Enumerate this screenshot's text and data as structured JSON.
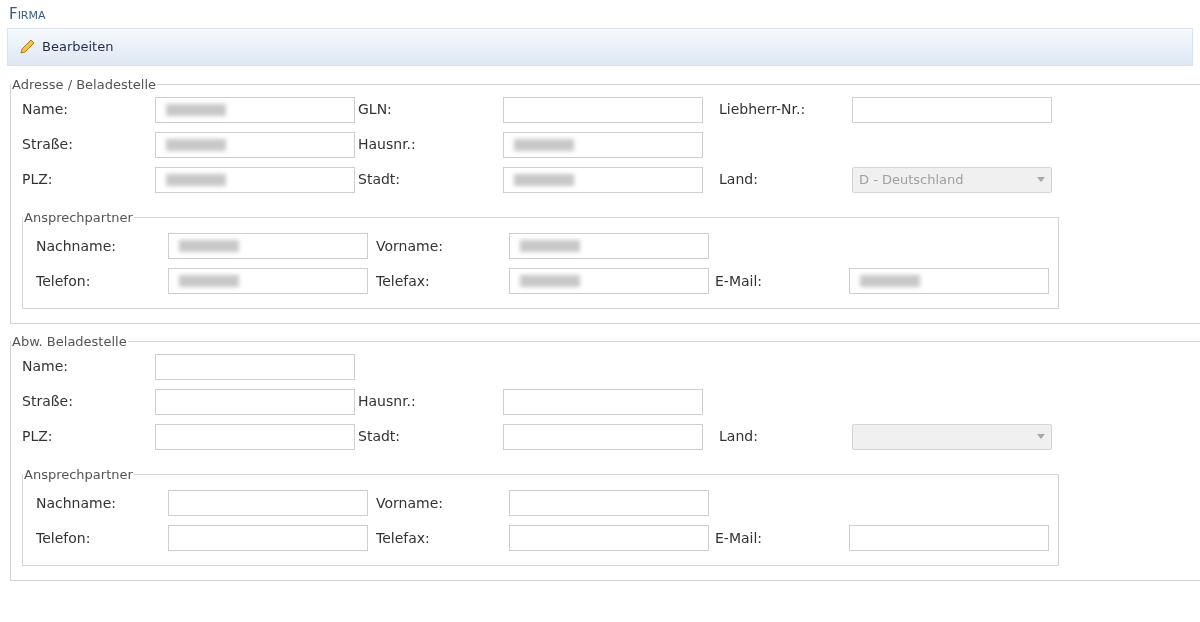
{
  "title": "Firma",
  "toolbar": [
    {
      "label": "Bearbeiten"
    }
  ],
  "sections": [
    {
      "legend": "Adresse / Beladestelle",
      "rows": [
        [
          {
            "label": "Name:",
            "field": {
              "kind": "text",
              "redacted": true
            }
          },
          {
            "label": "GLN:",
            "field": {
              "kind": "text",
              "redacted": false
            }
          },
          {
            "label": "Liebherr-Nr.:",
            "field": {
              "kind": "text",
              "redacted": false
            }
          }
        ],
        [
          {
            "label": "Straße:",
            "field": {
              "kind": "text",
              "redacted": true
            }
          },
          {
            "label": "Hausnr.:",
            "field": {
              "kind": "text",
              "redacted": true
            }
          }
        ],
        [
          {
            "label": "PLZ:",
            "field": {
              "kind": "text",
              "redacted": true
            }
          },
          {
            "label": "Stadt:",
            "field": {
              "kind": "text",
              "redacted": true
            }
          },
          {
            "label": "Land:",
            "field": {
              "kind": "select",
              "value": "D - Deutschland",
              "redacted": false
            }
          }
        ]
      ],
      "contact": {
        "legend": "Ansprechpartner",
        "rows": [
          [
            {
              "label": "Nachname:",
              "field": {
                "kind": "text",
                "redacted": true
              }
            },
            {
              "label": "Vorname:",
              "field": {
                "kind": "text",
                "redacted": true
              }
            }
          ],
          [
            {
              "label": "Telefon:",
              "field": {
                "kind": "text",
                "redacted": true
              }
            },
            {
              "label": "Telefax:",
              "field": {
                "kind": "text",
                "redacted": true
              }
            },
            {
              "label": "E-Mail:",
              "field": {
                "kind": "text",
                "redacted": true
              }
            }
          ]
        ]
      }
    },
    {
      "legend": "Abw. Beladestelle",
      "rows": [
        [
          {
            "label": "Name:",
            "field": {
              "kind": "text",
              "redacted": false
            }
          }
        ],
        [
          {
            "label": "Straße:",
            "field": {
              "kind": "text",
              "redacted": false
            }
          },
          {
            "label": "Hausnr.:",
            "field": {
              "kind": "text",
              "redacted": false
            }
          }
        ],
        [
          {
            "label": "PLZ:",
            "field": {
              "kind": "text",
              "redacted": false
            }
          },
          {
            "label": "Stadt:",
            "field": {
              "kind": "text",
              "redacted": false
            }
          },
          {
            "label": "Land:",
            "field": {
              "kind": "select",
              "redacted": false
            }
          }
        ]
      ],
      "contact": {
        "legend": "Ansprechpartner",
        "rows": [
          [
            {
              "label": "Nachname:",
              "field": {
                "kind": "text",
                "redacted": false
              }
            },
            {
              "label": "Vorname:",
              "field": {
                "kind": "text",
                "redacted": false
              }
            }
          ],
          [
            {
              "label": "Telefon:",
              "field": {
                "kind": "text",
                "redacted": false
              }
            },
            {
              "label": "Telefax:",
              "field": {
                "kind": "text",
                "redacted": false
              }
            },
            {
              "label": "E-Mail:",
              "field": {
                "kind": "text",
                "redacted": false
              }
            }
          ]
        ]
      }
    }
  ]
}
